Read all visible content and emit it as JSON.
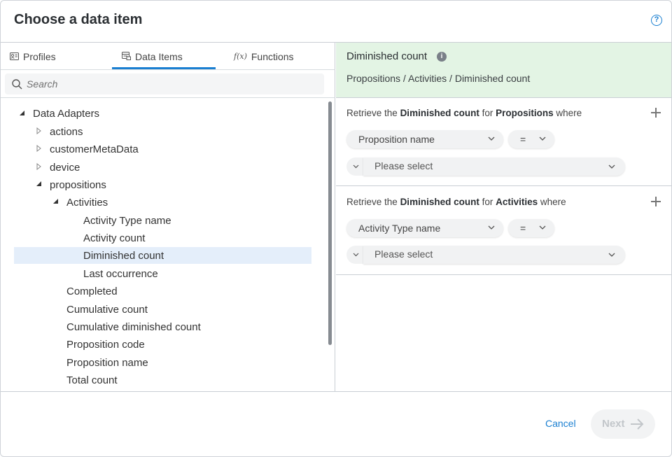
{
  "dialog": {
    "title": "Choose a data item",
    "help_icon": "question-circle-icon"
  },
  "tabs": [
    {
      "label": "Profiles",
      "icon": "profile-card-icon"
    },
    {
      "label": "Data Items",
      "icon": "data-items-icon",
      "active": true
    },
    {
      "label": "Functions",
      "icon": "function-fx-icon"
    }
  ],
  "search": {
    "placeholder": "Search"
  },
  "tree": {
    "root": "Data Adapters",
    "items": [
      "actions",
      "customerMetaData",
      "device",
      "propositions",
      "Activities",
      "Activity Type name",
      "Activity count",
      "Diminished count",
      "Last occurrence",
      "Completed",
      "Cumulative count",
      "Cumulative diminished count",
      "Proposition code",
      "Proposition name",
      "Total count"
    ],
    "selected": "Diminished count"
  },
  "info": {
    "title": "Diminished count",
    "path": "Propositions / Activities / Diminished count"
  },
  "conditions": [
    {
      "prefix": "Retrieve the",
      "item": "Diminished count",
      "for_word": "for",
      "entity": "Propositions",
      "suffix": "where",
      "field": "Proposition name",
      "operator": "=",
      "value_placeholder": "Please select"
    },
    {
      "prefix": "Retrieve the",
      "item": "Diminished count",
      "for_word": "for",
      "entity": "Activities",
      "suffix": "where",
      "field": "Activity Type name",
      "operator": "=",
      "value_placeholder": "Please select"
    }
  ],
  "footer": {
    "cancel": "Cancel",
    "next": "Next"
  },
  "colors": {
    "accent": "#1a7fd1",
    "info_bg": "#e3f4e4",
    "selected_bg": "#e4eefa"
  }
}
